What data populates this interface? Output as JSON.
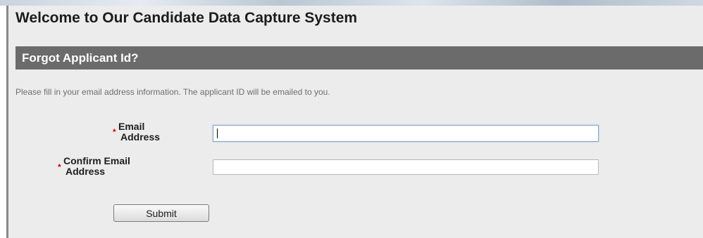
{
  "page": {
    "title": "Welcome to Our Candidate Data Capture System"
  },
  "section": {
    "title": "Forgot Applicant Id?",
    "instructions": "Please fill in your email address information. The applicant ID will be emailed to you."
  },
  "form": {
    "required_marker": "*",
    "email": {
      "label_line1": "Email",
      "label_line2": "Address",
      "value": "",
      "placeholder": ""
    },
    "confirm_email": {
      "label_line1": "Confirm Email",
      "label_line2": "Address",
      "value": "",
      "placeholder": ""
    },
    "submit_label": "Submit"
  },
  "colors": {
    "header_bar": "#6b6b6b",
    "panel_background": "#ececec",
    "required_star": "#d40000"
  }
}
